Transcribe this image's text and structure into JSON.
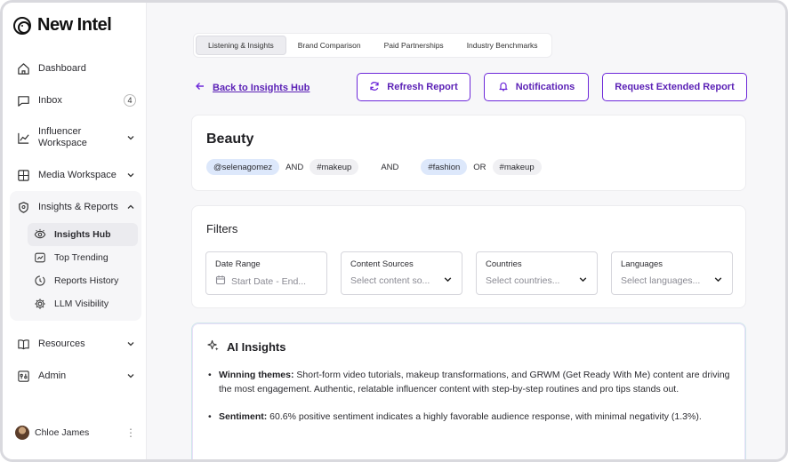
{
  "app": {
    "name": "New Intel"
  },
  "sidebar": {
    "items": [
      {
        "label": "Dashboard",
        "icon": "home-icon"
      },
      {
        "label": "Inbox",
        "icon": "message-icon",
        "badge": "4"
      },
      {
        "label": "Influencer Workspace",
        "icon": "chart-line-icon"
      },
      {
        "label": "Media Workspace",
        "icon": "media-icon"
      },
      {
        "label": "Insights & Reports",
        "icon": "shield-icon"
      }
    ],
    "sub_items": [
      {
        "label": "Insights Hub",
        "icon": "eye-icon"
      },
      {
        "label": "Top Trending",
        "icon": "trending-icon"
      },
      {
        "label": "Reports History",
        "icon": "history-icon"
      },
      {
        "label": "LLM Visibility",
        "icon": "gear-icon"
      }
    ],
    "bottom_items": [
      {
        "label": "Resources",
        "icon": "book-icon"
      },
      {
        "label": "Admin",
        "icon": "admin-icon"
      }
    ],
    "user": {
      "name": "Chloe James"
    }
  },
  "tabs": [
    "Listening & Insights",
    "Brand Comparison",
    "Paid Partnerships",
    "Industry Benchmarks"
  ],
  "actions": {
    "back": "Back to Insights Hub",
    "refresh": "Refresh Report",
    "notifications": "Notifications",
    "extended": "Request Extended Report"
  },
  "query": {
    "title": "Beauty",
    "chips": [
      "@selenagomez",
      "AND",
      "#makeup",
      "AND",
      "#fashion",
      "OR",
      "#makeup"
    ]
  },
  "filters": {
    "title": "Filters",
    "fields": [
      {
        "label": "Date Range",
        "placeholder": "Start Date - End..."
      },
      {
        "label": "Content Sources",
        "placeholder": "Select content so..."
      },
      {
        "label": "Countries",
        "placeholder": "Select countries..."
      },
      {
        "label": "Languages",
        "placeholder": "Select languages..."
      }
    ]
  },
  "ai": {
    "title": "AI Insights",
    "bullets": [
      {
        "head": "Winning themes:",
        "text": " Short-form video tutorials, makeup transformations, and GRWM (Get Ready With Me) content are driving the most engagement. Authentic, relatable influencer content with step-by-step routines and pro tips stands out."
      },
      {
        "head": "Sentiment:",
        "text": " 60.6% positive sentiment indicates a highly favorable audience response, with minimal negativity (1.3%)."
      }
    ]
  },
  "colors": {
    "accent": "#6d28d9",
    "chip_blue": "#dde8fb"
  }
}
